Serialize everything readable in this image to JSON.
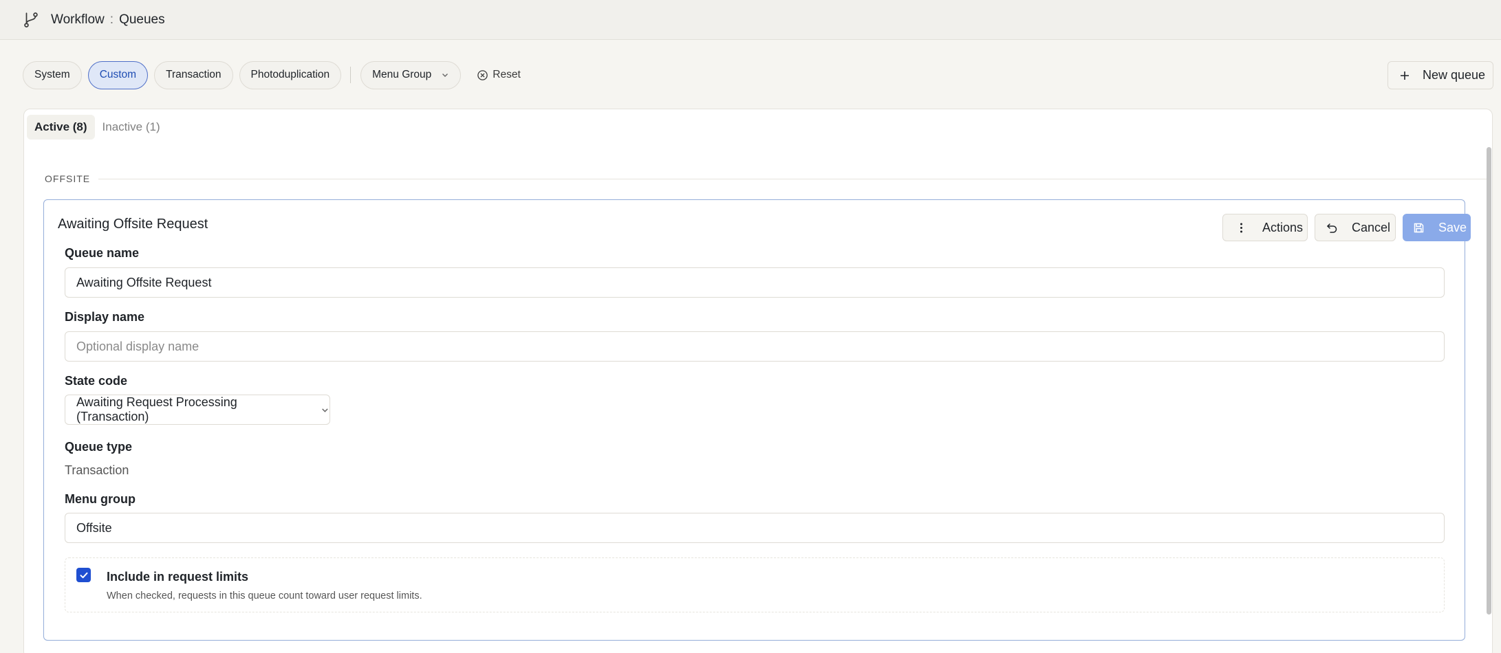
{
  "breadcrumb": {
    "section": "Workflow",
    "separator": ":",
    "page": "Queues"
  },
  "filters": {
    "chips": [
      {
        "label": "System",
        "active": false
      },
      {
        "label": "Custom",
        "active": true
      },
      {
        "label": "Transaction",
        "active": false
      },
      {
        "label": "Photoduplication",
        "active": false
      }
    ],
    "menu_group_label": "Menu Group",
    "reset_label": "Reset"
  },
  "new_queue_label": "New queue",
  "tabs": [
    {
      "label": "Active (8)",
      "active": true
    },
    {
      "label": "Inactive (1)",
      "active": false
    }
  ],
  "section": {
    "title": "OFFSITE"
  },
  "card": {
    "title": "Awaiting Offsite Request",
    "actions_label": "Actions",
    "cancel_label": "Cancel",
    "save_label": "Save",
    "queue_name": {
      "label": "Queue name",
      "value": "Awaiting Offsite Request"
    },
    "display_name": {
      "label": "Display name",
      "value": "",
      "placeholder": "Optional display name"
    },
    "state_code": {
      "label": "State code",
      "value": "Awaiting Request Processing (Transaction)"
    },
    "queue_type": {
      "label": "Queue type",
      "value": "Transaction"
    },
    "menu_group": {
      "label": "Menu group",
      "value": "Offsite"
    },
    "request_limits": {
      "label": "Include in request limits",
      "help": "When checked, requests in this queue count toward user request limits.",
      "checked": true
    }
  },
  "colors": {
    "accent": "#1f4fd1",
    "save_disabled": "#8aaae9",
    "active_chip_bg": "#dfe7f7"
  }
}
